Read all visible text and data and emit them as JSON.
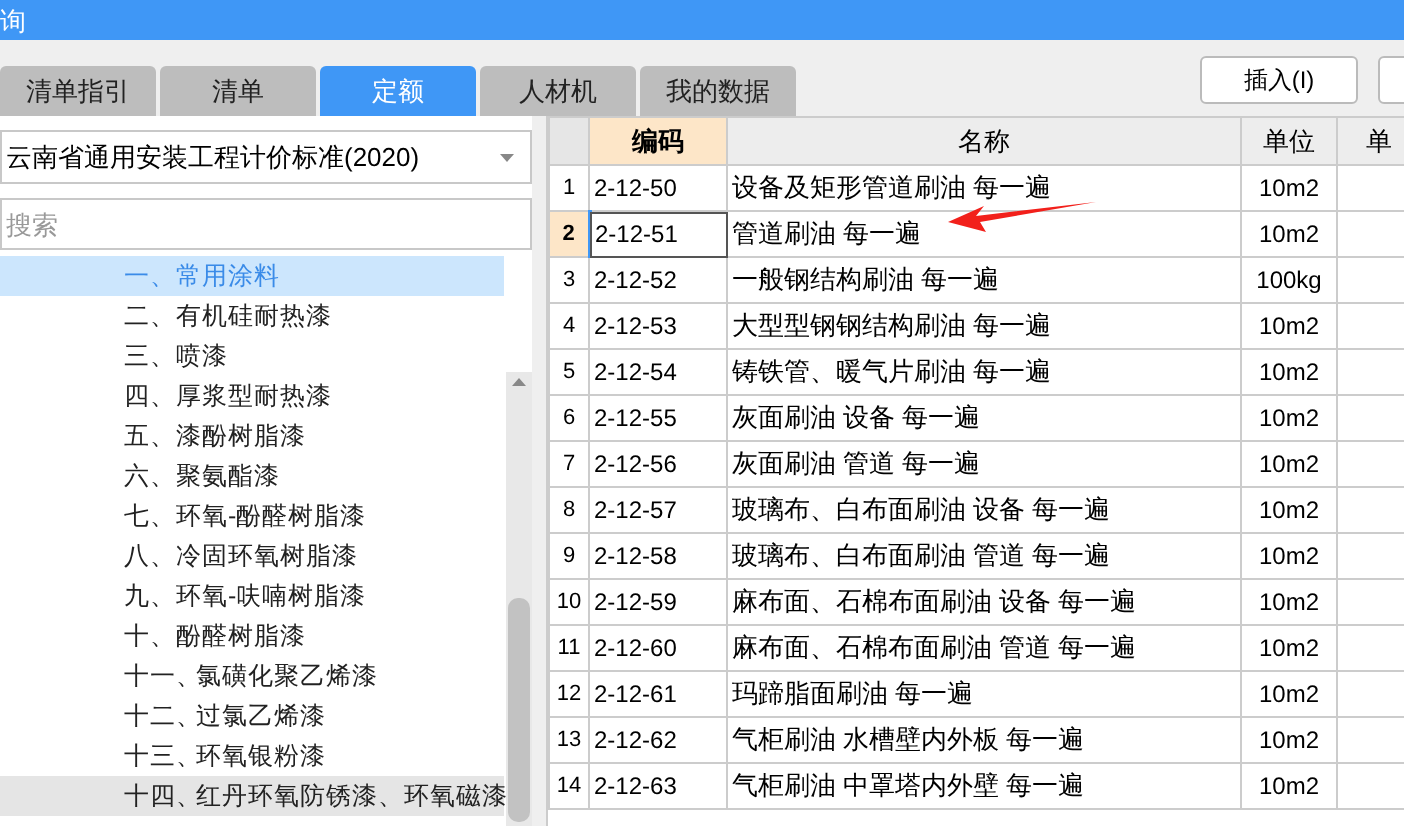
{
  "window": {
    "title": "询"
  },
  "tabs": [
    {
      "label": "清单指引",
      "selected": false
    },
    {
      "label": "清单",
      "selected": false
    },
    {
      "label": "定额",
      "selected": true
    },
    {
      "label": "人材机",
      "selected": false
    },
    {
      "label": "我的数据",
      "selected": false
    }
  ],
  "toolbar": {
    "buttons": [
      "插入(I)"
    ]
  },
  "sidebar": {
    "standard": "云南省通用安装工程计价标准(2020)",
    "search": {
      "placeholder": "搜索"
    },
    "items": [
      {
        "number": "一、",
        "label": "常用涂料",
        "selected": true,
        "hovered": false
      },
      {
        "number": "二、",
        "label": "有机硅耐热漆",
        "selected": false,
        "hovered": false
      },
      {
        "number": "三、",
        "label": "喷漆",
        "selected": false,
        "hovered": false
      },
      {
        "number": "四、",
        "label": "厚浆型耐热漆",
        "selected": false,
        "hovered": false
      },
      {
        "number": "五、",
        "label": "漆酚树脂漆",
        "selected": false,
        "hovered": false
      },
      {
        "number": "六、",
        "label": "聚氨酯漆",
        "selected": false,
        "hovered": false
      },
      {
        "number": "七、",
        "label": "环氧-酚醛树脂漆",
        "selected": false,
        "hovered": false
      },
      {
        "number": "八、",
        "label": "冷固环氧树脂漆",
        "selected": false,
        "hovered": false
      },
      {
        "number": "九、",
        "label": "环氧-呋喃树脂漆",
        "selected": false,
        "hovered": false
      },
      {
        "number": "十、",
        "label": "酚醛树脂漆",
        "selected": false,
        "hovered": false
      },
      {
        "number": "十一、",
        "label": "氯磺化聚乙烯漆",
        "selected": false,
        "hovered": false
      },
      {
        "number": "十二、",
        "label": "过氯乙烯漆",
        "selected": false,
        "hovered": false
      },
      {
        "number": "十三、",
        "label": "环氧银粉漆",
        "selected": false,
        "hovered": false
      },
      {
        "number": "十四、",
        "label": "红丹环氧防锈漆、环氧磁漆",
        "selected": false,
        "hovered": true
      }
    ]
  },
  "table": {
    "columns": [
      "编码",
      "名称",
      "单位",
      "单"
    ],
    "rows": [
      {
        "index": "1",
        "code": "2-12-50",
        "name": "设备及矩形管道刷油 每一遍",
        "unit": "10m2",
        "selected": false
      },
      {
        "index": "2",
        "code": "2-12-51",
        "name": "管道刷油 每一遍",
        "unit": "10m2",
        "selected": true
      },
      {
        "index": "3",
        "code": "2-12-52",
        "name": "一般钢结构刷油 每一遍",
        "unit": "100kg",
        "selected": false
      },
      {
        "index": "4",
        "code": "2-12-53",
        "name": "大型型钢钢结构刷油 每一遍",
        "unit": "10m2",
        "selected": false
      },
      {
        "index": "5",
        "code": "2-12-54",
        "name": "铸铁管、暖气片刷油 每一遍",
        "unit": "10m2",
        "selected": false
      },
      {
        "index": "6",
        "code": "2-12-55",
        "name": "灰面刷油 设备 每一遍",
        "unit": "10m2",
        "selected": false
      },
      {
        "index": "7",
        "code": "2-12-56",
        "name": "灰面刷油 管道 每一遍",
        "unit": "10m2",
        "selected": false
      },
      {
        "index": "8",
        "code": "2-12-57",
        "name": "玻璃布、白布面刷油 设备 每一遍",
        "unit": "10m2",
        "selected": false
      },
      {
        "index": "9",
        "code": "2-12-58",
        "name": "玻璃布、白布面刷油 管道 每一遍",
        "unit": "10m2",
        "selected": false
      },
      {
        "index": "10",
        "code": "2-12-59",
        "name": "麻布面、石棉布面刷油 设备 每一遍",
        "unit": "10m2",
        "selected": false
      },
      {
        "index": "11",
        "code": "2-12-60",
        "name": "麻布面、石棉布面刷油 管道 每一遍",
        "unit": "10m2",
        "selected": false
      },
      {
        "index": "12",
        "code": "2-12-61",
        "name": "玛蹄脂面刷油 每一遍",
        "unit": "10m2",
        "selected": false
      },
      {
        "index": "13",
        "code": "2-12-62",
        "name": "气柜刷油 水槽壁内外板 每一遍",
        "unit": "10m2",
        "selected": false
      },
      {
        "index": "14",
        "code": "2-12-63",
        "name": "气柜刷油 中罩塔内外壁 每一遍",
        "unit": "10m2",
        "selected": false
      }
    ]
  }
}
